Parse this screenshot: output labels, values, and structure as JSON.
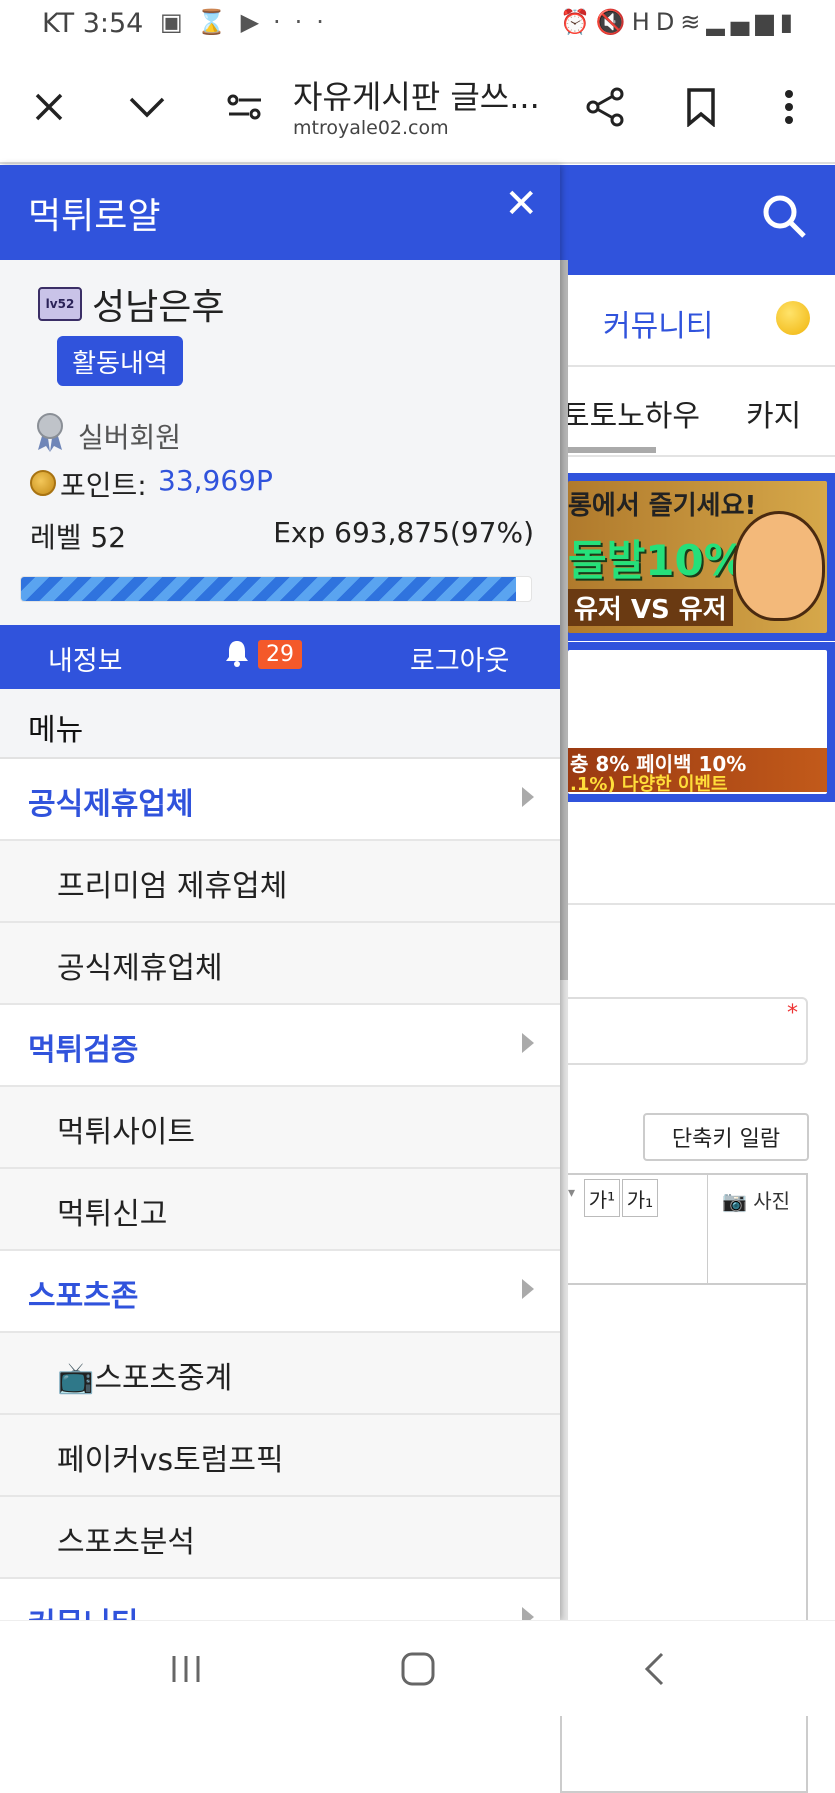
{
  "status_bar": {
    "carrier": "KT",
    "time": "3:54",
    "icons": [
      "image-icon",
      "hourglass-icon",
      "play-store-icon",
      "more-dots-icon"
    ],
    "right_icons": [
      "alarm-icon",
      "mute-icon",
      "hd-icon",
      "wifi-icon",
      "signal-icon",
      "battery-icon"
    ]
  },
  "browser": {
    "title": "자유게시판 글쓰...",
    "url": "mtroyale02.com"
  },
  "background_page": {
    "tab_community": "커뮤니티",
    "tab_toto": "토토노하우",
    "tab_casino": "카지",
    "banner1_line1": "롱에서 즐기세요!",
    "banner1_line2": "돌발10%",
    "banner1_line3": "유저 VS 유저",
    "banner2_line1": "충 8% 페이백 10%",
    "banner2_line2": ".1%) 다양한 이벤트",
    "shortcut_button": "단축키 일람",
    "photo_button": "사진",
    "tool_sup": "가¹",
    "tool_sub": "가₁"
  },
  "drawer": {
    "title": "먹튀로얄",
    "user": {
      "level_badge": "lv52",
      "name": "성남은후",
      "activity_button": "활동내역",
      "grade": "실버회원",
      "points_label": "포인트:",
      "points_value": "33,969P",
      "level_text": "레벨 52",
      "exp_text": "Exp 693,875(97%)",
      "exp_progress_percent": 97
    },
    "userbar": {
      "my_info": "내정보",
      "notification_count": "29",
      "logout": "로그아웃"
    },
    "menu_header": "메뉴",
    "menu_items": [
      {
        "label": "공식제휴업체",
        "type": "category"
      },
      {
        "label": "프리미엄 제휴업체",
        "type": "sub"
      },
      {
        "label": "공식제휴업체",
        "type": "sub"
      },
      {
        "label": "먹튀검증",
        "type": "category"
      },
      {
        "label": "먹튀사이트",
        "type": "sub"
      },
      {
        "label": "먹튀신고",
        "type": "sub"
      },
      {
        "label": "스포츠존",
        "type": "category"
      },
      {
        "label": "📺스포츠중계",
        "type": "sub"
      },
      {
        "label": "페이커vs토럼프픽",
        "type": "sub"
      },
      {
        "label": "스포츠분석",
        "type": "sub"
      },
      {
        "label": "커뮤니티",
        "type": "category"
      }
    ]
  },
  "colors": {
    "brand_blue": "#3053dc",
    "badge_orange": "#f4592a"
  }
}
